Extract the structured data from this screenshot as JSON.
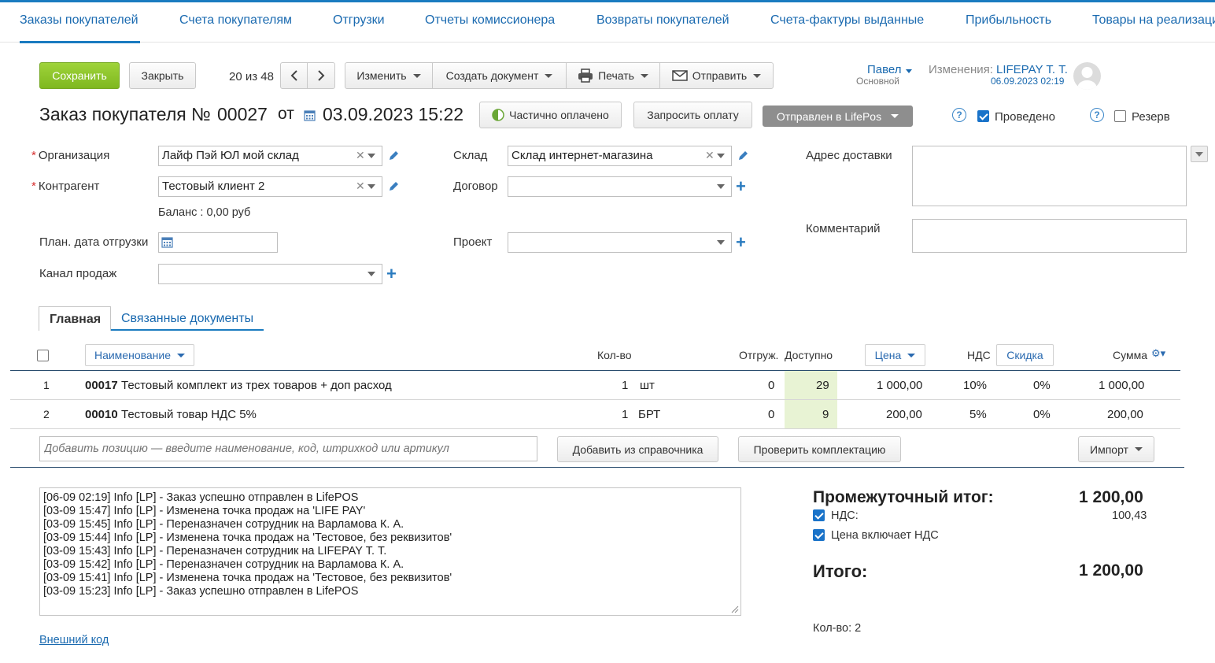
{
  "topnav": {
    "items": [
      "Заказы покупателей",
      "Счета покупателям",
      "Отгрузки",
      "Отчеты комиссионера",
      "Возвраты покупателей",
      "Счета-фактуры выданные",
      "Прибыльность",
      "Товары на реализаци"
    ]
  },
  "toolbar": {
    "save_label": "Сохранить",
    "close_label": "Закрыть",
    "pager_text": "20 из 48",
    "change_label": "Изменить",
    "create_doc_label": "Создать документ",
    "print_label": "Печать",
    "send_label": "Отправить"
  },
  "user": {
    "name": "Павел",
    "role": "Основной",
    "changes_label": "Изменения:",
    "changes_user": "LIFEPAY Т. Т.",
    "changes_date": "06.09.2023 02:19"
  },
  "doc": {
    "title_prefix": "Заказ покупателя №",
    "number": "00027",
    "from_label": "от",
    "date": "03.09.2023 15:22",
    "payment_status": "Частично оплачено",
    "request_payment": "Запросить оплату",
    "sent_status": "Отправлен в LifePos",
    "posted_label": "Проведено",
    "reserve_label": "Резерв",
    "posted_checked": true,
    "reserve_checked": false
  },
  "form": {
    "org_label": "Организация",
    "org_value": "Лайф Пэй ЮЛ мой склад",
    "counterparty_label": "Контрагент",
    "counterparty_value": "Тестовый клиент 2",
    "balance": "Баланс : 0,00 руб",
    "ship_date_label": "План. дата отгрузки",
    "channel_label": "Канал продаж",
    "warehouse_label": "Склад",
    "warehouse_value": "Склад интернет-магазина",
    "contract_label": "Договор",
    "project_label": "Проект",
    "address_label": "Адрес доставки",
    "comment_label": "Комментарий"
  },
  "tabs": {
    "main": "Главная",
    "related": "Связанные документы"
  },
  "table": {
    "headers": {
      "name": "Наименование",
      "qty": "Кол-во",
      "shipped": "Отгруж.",
      "available": "Доступно",
      "price": "Цена",
      "vat": "НДС",
      "discount": "Скидка",
      "sum": "Сумма"
    },
    "rows": [
      {
        "n": "1",
        "code": "00017",
        "name": "Тестовый комплект из трех товаров + доп расход",
        "qty": "1",
        "unit": "шт",
        "shipped": "0",
        "available": "29",
        "price": "1 000,00",
        "vat": "10%",
        "discount": "0%",
        "sum": "1 000,00"
      },
      {
        "n": "2",
        "code": "00010",
        "name": "Тестовый товар НДС 5%",
        "qty": "1",
        "unit": "БРТ",
        "shipped": "0",
        "available": "9",
        "price": "200,00",
        "vat": "5%",
        "discount": "0%",
        "sum": "200,00"
      }
    ],
    "add_placeholder": "Добавить позицию — введите наименование, код, штрихкод или артикул",
    "add_from_catalog": "Добавить из справочника",
    "check_kit": "Проверить комплектацию",
    "import": "Импорт"
  },
  "log": [
    "[06-09 02:19] Info [LP] - Заказ успешно отправлен в LifePOS",
    "[03-09 15:47] Info [LP] - Изменена точка продаж на 'LIFE PAY'",
    "[03-09 15:45] Info [LP] - Переназначен сотрудник на Варламова К. А.",
    "[03-09 15:44] Info [LP] - Изменена точка продаж на 'Тестовое, без реквизитов'",
    "[03-09 15:43] Info [LP] - Переназначен сотрудник на LIFEPAY Т. Т.",
    "[03-09 15:42] Info [LP] - Переназначен сотрудник на Варламова К. А.",
    "[03-09 15:41] Info [LP] - Изменена точка продаж на 'Тестовое, без реквизитов'",
    "[03-09 15:23] Info [LP] - Заказ успешно отправлен в LifePOS"
  ],
  "external_code": "Внешний код",
  "totals": {
    "subtotal_label": "Промежуточный итог:",
    "subtotal": "1 200,00",
    "vat_label": "НДС:",
    "vat": "100,43",
    "price_incl_vat_label": "Цена включает НДС",
    "total_label": "Итого:",
    "total": "1 200,00",
    "count": "Кол-во: 2"
  },
  "colors": {
    "accent": "#1a7bc0",
    "save_green": "#8cc42b",
    "available_bg": "#e8f3d4"
  }
}
